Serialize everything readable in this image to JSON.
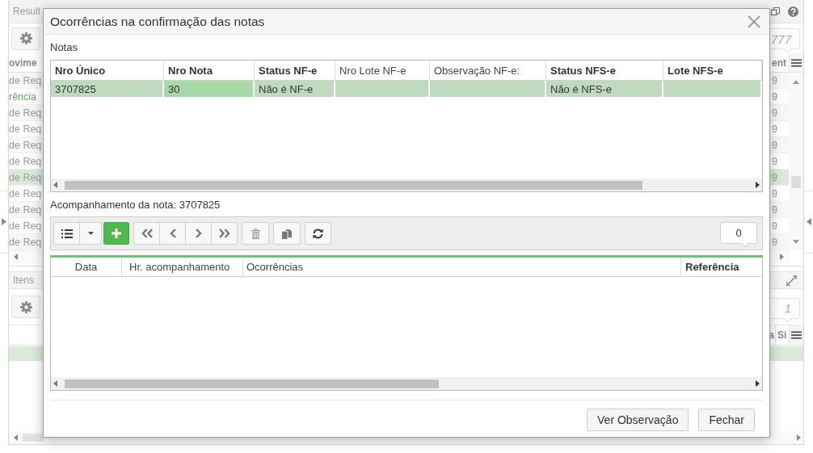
{
  "background": {
    "top_panel": {
      "title": "Result",
      "counter": "777",
      "columns": [
        "ovime",
        "ent"
      ],
      "rows": [
        {
          "cells": [
            "de Req",
            "9"
          ],
          "selected": false,
          "highlighted": false
        },
        {
          "cells": [
            "rência",
            "9"
          ],
          "selected": false,
          "highlighted": true
        },
        {
          "cells": [
            "de Req",
            "9"
          ],
          "selected": false,
          "highlighted": false
        },
        {
          "cells": [
            "de Req",
            "9"
          ],
          "selected": false,
          "highlighted": false
        },
        {
          "cells": [
            "de Req",
            "9"
          ],
          "selected": false,
          "highlighted": false
        },
        {
          "cells": [
            "de Req",
            "9"
          ],
          "selected": false,
          "highlighted": false
        },
        {
          "cells": [
            "de Req",
            "9"
          ],
          "selected": true,
          "highlighted": false
        },
        {
          "cells": [
            "de Req",
            "9"
          ],
          "selected": false,
          "highlighted": false
        },
        {
          "cells": [
            "de Req",
            "9"
          ],
          "selected": false,
          "highlighted": false
        },
        {
          "cells": [
            "de Req",
            "9"
          ],
          "selected": false,
          "highlighted": false
        },
        {
          "cells": [
            "de Req",
            "9"
          ],
          "selected": false,
          "highlighted": false
        }
      ]
    },
    "bottom_panel": {
      "title": "Itens",
      "counter": "1",
      "columns": [
        "a",
        "Si"
      ],
      "rows": [
        {
          "selected": true
        }
      ]
    }
  },
  "dialog": {
    "title": "Ocorrências na confirmação das notas",
    "notes": {
      "label": "Notas",
      "columns": [
        {
          "label": "Nro Único",
          "emphasized": true
        },
        {
          "label": "Nro Nota",
          "emphasized": true
        },
        {
          "label": "Status NF-e",
          "emphasized": true
        },
        {
          "label": "Nro Lote NF-e",
          "emphasized": false
        },
        {
          "label": "Observação NF-e:",
          "emphasized": false
        },
        {
          "label": "Status NFS-e",
          "emphasized": true
        },
        {
          "label": "Lote NFS-e",
          "emphasized": true
        }
      ],
      "rows": [
        {
          "selected": true,
          "cells": [
            {
              "text": "3707825",
              "focused": false
            },
            {
              "text": "30",
              "focused": true
            },
            {
              "text": "Não é NF-e",
              "focused": false
            },
            {
              "focused": false
            },
            {
              "focused": false
            },
            {
              "text": "Não é NFS-e",
              "focused": false
            },
            {
              "focused": false
            }
          ]
        }
      ]
    },
    "follow_up": {
      "label": "Acompanhamento da nota: 3707825",
      "toolbar": [
        {
          "buttons": [
            {
              "kind": "list"
            },
            {
              "kind": "dropdown"
            }
          ]
        },
        {
          "buttons": [
            {
              "kind": "add"
            }
          ]
        },
        {
          "buttons": [
            {
              "kind": "first"
            },
            {
              "kind": "previous"
            },
            {
              "kind": "next"
            },
            {
              "kind": "last"
            }
          ]
        },
        {
          "buttons": [
            {
              "kind": "delete"
            }
          ]
        },
        {
          "buttons": [
            {
              "kind": "duplicate"
            }
          ]
        },
        {
          "buttons": [
            {
              "kind": "refresh"
            }
          ]
        }
      ],
      "counter": "0",
      "columns": [
        {
          "label": "Data",
          "emphasized": false
        },
        {
          "label": "Hr. acompanhamento",
          "emphasized": false
        },
        {
          "label": "Ocorrências",
          "emphasized": false
        },
        {
          "label": "Referência",
          "emphasized": true
        }
      ]
    },
    "buttons": [
      "Ver Observação",
      "Fechar"
    ]
  }
}
